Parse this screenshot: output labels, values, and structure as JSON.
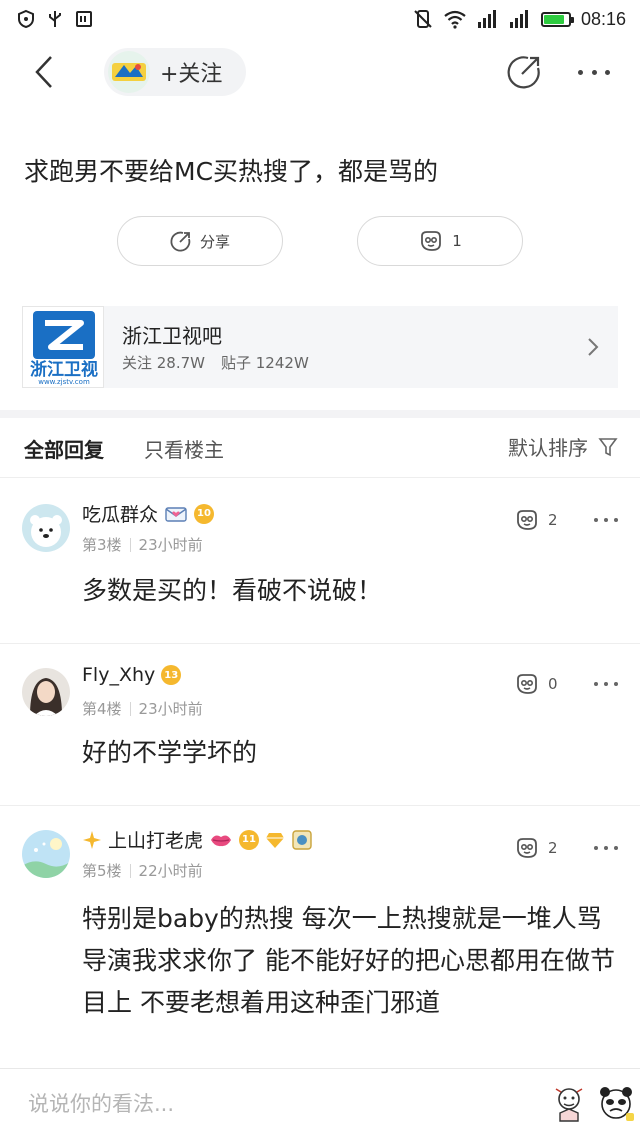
{
  "status_bar": {
    "time": "08:16",
    "battery_level": 0.85
  },
  "nav": {
    "follow_label": "+关注"
  },
  "post": {
    "title": "求跑男不要给MC买热搜了，都是骂的",
    "share_label": "分享",
    "like_count": "1"
  },
  "forum": {
    "name": "浙江卫视吧",
    "followers": "关注 28.7W",
    "posts": "贴子 1242W",
    "logo_text": "浙江卫视",
    "logo_url_text": "www.zjstv.com"
  },
  "tabs": {
    "all_replies": "全部回复",
    "owner_only": "只看楼主",
    "sort_label": "默认排序"
  },
  "comments": [
    {
      "username": "吃瓜群众",
      "level": "10",
      "floor": "第3楼",
      "time": "23小时前",
      "likes": "2",
      "text": "多数是买的！看破不说破！"
    },
    {
      "username": "Fly_Xhy",
      "level": "13",
      "floor": "第4楼",
      "time": "23小时前",
      "likes": "0",
      "text": "好的不学学坏的"
    },
    {
      "username": "上山打老虎",
      "level": "11",
      "floor": "第5楼",
      "time": "22小时前",
      "likes": "2",
      "text": "特别是baby的热搜 每次一上热搜就是一堆人骂 导演我求求你了 能不能好好的把心思都用在做节目上 不要老想着用这种歪门邪道"
    }
  ],
  "reply_bar": {
    "placeholder": "说说你的看法..."
  },
  "colors": {
    "accent_gold": "#f5b82e",
    "zjtv_blue": "#1a6fc4",
    "battery_green": "#2ecc40"
  }
}
